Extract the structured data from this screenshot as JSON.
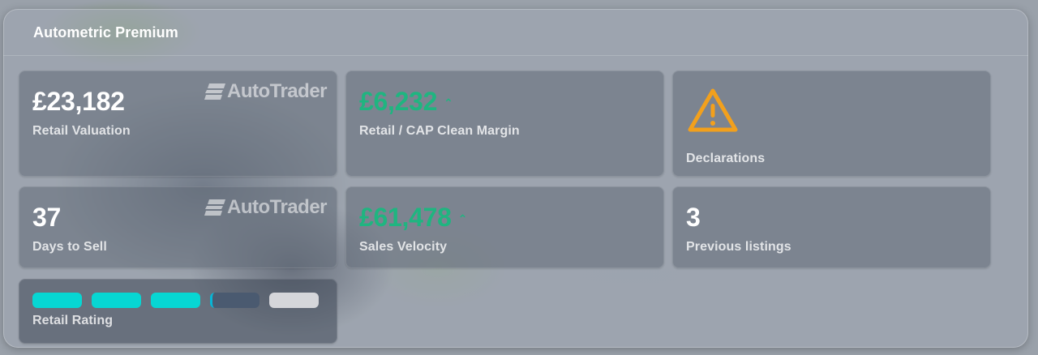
{
  "panel": {
    "title": "Autometric Premium"
  },
  "cards": {
    "retail_valuation": {
      "value": "£23,182",
      "label": "Retail Valuation",
      "logo_text": "AutoTrader"
    },
    "margin": {
      "value": "£6,232",
      "label": "Retail / CAP Clean Margin",
      "trend_icon": "chevron-up-icon",
      "color": "#1fb580"
    },
    "declarations": {
      "label": "Declarations",
      "icon": "warning-icon",
      "icon_color": "#f2a01c"
    },
    "days_to_sell": {
      "value": "37",
      "label": "Days to Sell",
      "logo_text": "AutoTrader"
    },
    "sales_velocity": {
      "value": "£61,478",
      "label": "Sales Velocity",
      "trend_icon": "chevron-up-icon",
      "color": "#1fb580"
    },
    "previous_listings": {
      "value": "3",
      "label": "Previous listings"
    },
    "retail_rating": {
      "label": "Retail Rating",
      "segments_total": 5,
      "segments_filled": 3,
      "partial_segment_fraction": 0.05,
      "filled_color": "#07d6d3",
      "empty_color": "#d5d6da"
    }
  }
}
